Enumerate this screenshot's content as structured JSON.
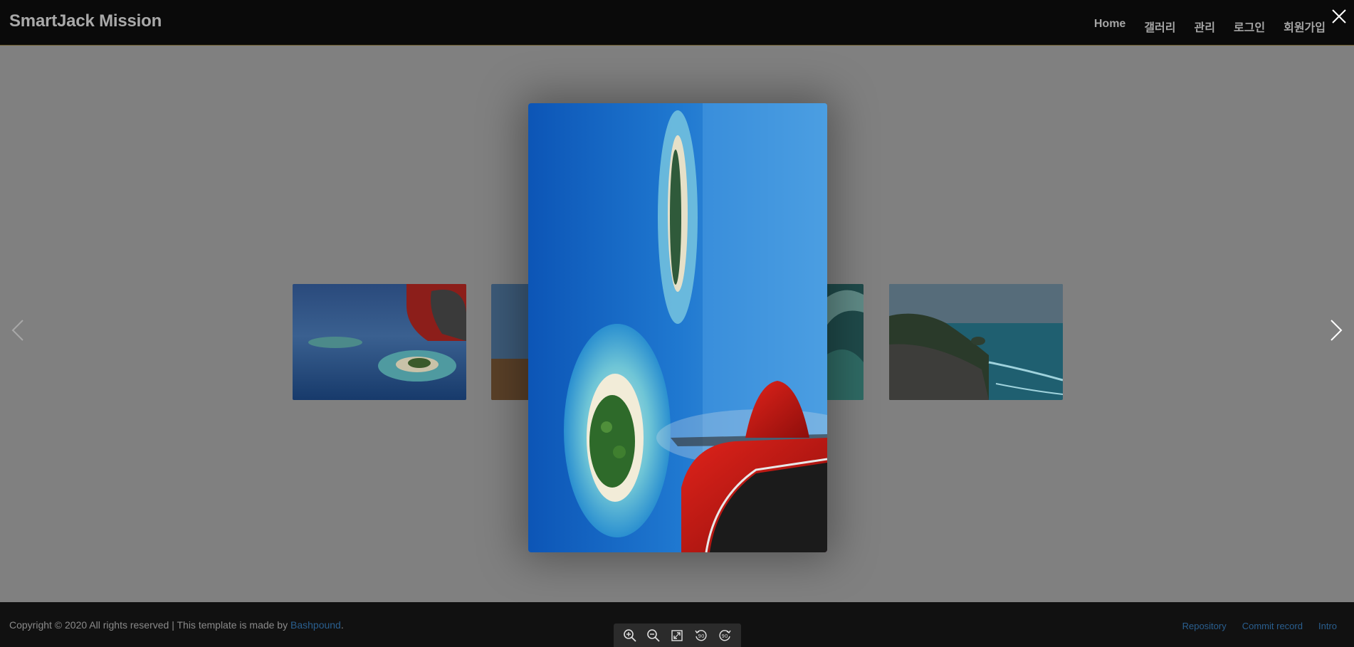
{
  "header": {
    "brand": "SmartJack Mission",
    "nav": [
      {
        "label": "Home"
      },
      {
        "label": "갤러리"
      },
      {
        "label": "관리"
      },
      {
        "label": "로그인"
      },
      {
        "label": "회원가입"
      }
    ],
    "close_icon": "close-icon"
  },
  "gallery": {
    "thumbnails": [
      {
        "subject": "aerial island with red propeller plane"
      },
      {
        "subject": "landscape"
      },
      {
        "subject": "sea waves"
      },
      {
        "subject": "coastal cliffs and sea"
      }
    ],
    "prev_icon": "chevron-left-icon",
    "next_icon": "chevron-right-icon"
  },
  "lightbox": {
    "subject": "aerial view of maldives island from red plane",
    "toolbar": [
      {
        "icon": "zoom-in-icon"
      },
      {
        "icon": "zoom-out-icon"
      },
      {
        "icon": "fullscreen-icon"
      },
      {
        "icon": "rotate-left-icon",
        "label": "90"
      },
      {
        "icon": "rotate-right-icon",
        "label": "90"
      }
    ]
  },
  "footer": {
    "copyright_text": "Copyright © 2020 All rights reserved | This template is made by ",
    "copyright_link": "Bashpound",
    "copyright_end": ".",
    "links": [
      {
        "label": "Repository"
      },
      {
        "label": "Commit record"
      },
      {
        "label": "Intro"
      }
    ]
  },
  "colors": {
    "navbar_bg": "#0a0a0a",
    "overlay": "#808080",
    "footer_bg": "#111111",
    "link": "#2a5f8f"
  }
}
